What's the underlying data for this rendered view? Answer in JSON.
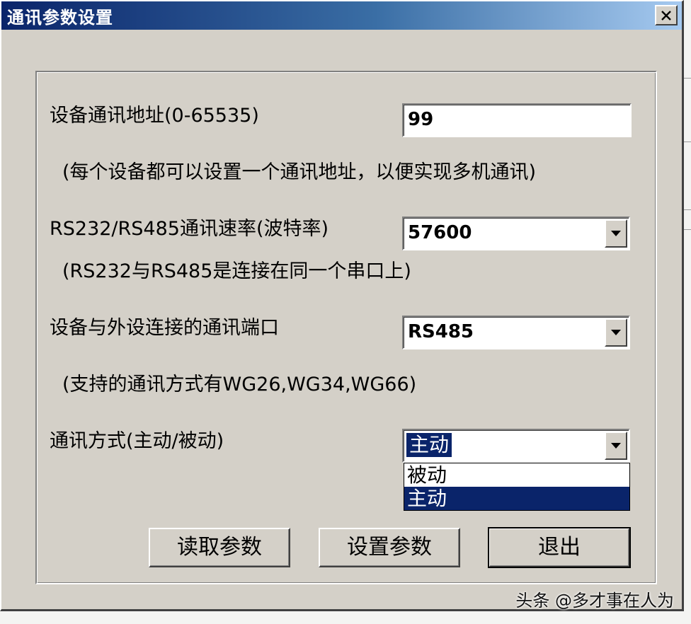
{
  "dialog": {
    "title": "通讯参数设置"
  },
  "fields": {
    "address": {
      "label": "设备通讯地址(0-65535)",
      "value": "99",
      "hint": "(每个设备都可以设置一个通讯地址，以便实现多机通讯)"
    },
    "baud": {
      "label": "RS232/RS485通讯速率(波特率)",
      "value": "57600",
      "hint": "(RS232与RS485是连接在同一个串口上)"
    },
    "port": {
      "label": "设备与外设连接的通讯端口",
      "value": "RS485",
      "hint": "(支持的通讯方式有WG26,WG34,WG66)"
    },
    "mode": {
      "label": "通讯方式(主动/被动)",
      "value": "主动",
      "options": [
        "被动",
        "主动"
      ]
    }
  },
  "buttons": {
    "read": "读取参数",
    "set": "设置参数",
    "exit": "退出"
  },
  "watermark": "头条 @多才事在人为",
  "colors": {
    "title_bar_start": "#0a246a",
    "title_bar_end": "#a6caf0",
    "selection": "#0a246a",
    "face": "#d4d0c8"
  }
}
